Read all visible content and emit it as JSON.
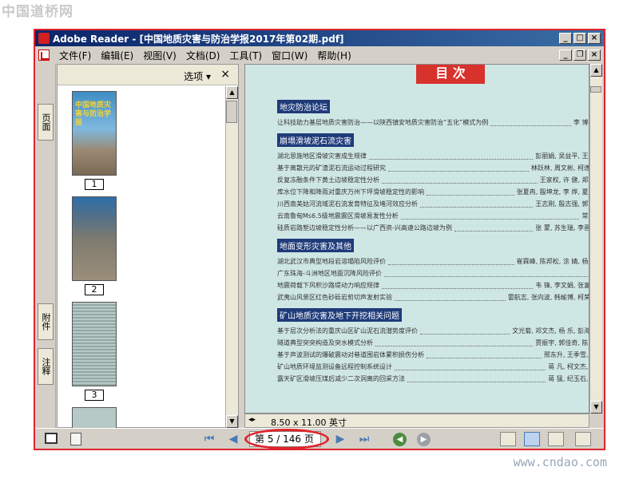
{
  "watermark_top": "中国道桥网",
  "watermark_bottom": "www.cndao.com",
  "window": {
    "title": "Adobe Reader - [中国地质灾害与防治学报2017年第02期.pdf]"
  },
  "menu": [
    "文件(F)",
    "编辑(E)",
    "视图(V)",
    "文档(D)",
    "工具(T)",
    "窗口(W)",
    "帮助(H)"
  ],
  "side_tabs": {
    "pages": "页面",
    "attachments": "附件",
    "comments": "注释"
  },
  "panel": {
    "options_label": "选项 ▾",
    "close": "×"
  },
  "thumbnails": [
    {
      "number": "1",
      "cover_text": "中国地质灾害与防治学报"
    },
    {
      "number": "2"
    },
    {
      "number": "3"
    }
  ],
  "document": {
    "toc_heading": "目 次",
    "sections": [
      {
        "title": "地灾防治论坛",
        "entries": [
          {
            "text": "让科技助力基层地质灾害防治——以陕西镇安地质灾害防治“五化”模式为例",
            "authors": "李 博  杨"
          }
        ]
      },
      {
        "title": "崩塌滑坡泥石流灾害",
        "entries": [
          {
            "text": "湖北恩施地区滑坡灾害成生规律",
            "authors": "彭丽娟, 吴益平, 王 飞"
          },
          {
            "text": "基于离散元的矿渣泥石流运动过程研究",
            "authors": "林跃林, 周文彬, 柯逸瑶"
          },
          {
            "text": "反复冻融条件下黄土边坡稳定性分析",
            "authors": "王家权, 许 健, 郑 刚"
          },
          {
            "text": "库水位下降和降雨对重庆万州下坪滑坡稳定性的影响",
            "authors": "张夏冉, 殷坤龙, 李 烨, 夏 辉"
          },
          {
            "text": "川西南美姑河流域泥石流发育特征及堵河效应分析",
            "authors": "王志刚, 殷志强, 郭 海"
          },
          {
            "text": "云南鲁甸Ms6.5级地震震区滑坡易发性分析",
            "authors": "常 昊"
          },
          {
            "text": "硅质岩路堑边坡稳定性分析——以广西资-兴高速公路边坡为例",
            "authors": "张 蒙, 苏生瑞, 李晋山"
          }
        ]
      },
      {
        "title": "地面变形灾害及其他",
        "entries": [
          {
            "text": "湖北武汉市典型地段岩溶塌陷风险评价",
            "authors": "崔霖峰, 陈邦松, 涂 婧, 杨 涛"
          },
          {
            "text": "广东珠海-斗洲地区地面沉降风险评价",
            "authors": ""
          },
          {
            "text": "地震荷载下风积沙路堤动力响应规律",
            "authors": "韦 锋, 李文娟, 张富贵"
          },
          {
            "text": "武夷山风景区红色砂砾岩剪切声发射实验",
            "authors": "雷航志, 张向波, 韩瑜博, 柯荣利"
          }
        ]
      },
      {
        "title": "矿山地质灾害及地下开挖相关问题",
        "entries": [
          {
            "text": "基于层次分析法的重庆山区矿山泥石流潜势度评价",
            "authors": "文光菊, 邓文杰, 杨 乐, 彭海游"
          },
          {
            "text": "隧道典型突突构造及突水模式分析",
            "authors": "贾振宇, 郭佳奇, 陈 帆"
          },
          {
            "text": "基于声波测试的爆破震动对巷道围岩体累积损伤分析",
            "authors": "邢东升, 王季雪, 刘"
          },
          {
            "text": "矿山地质环境监测设备远程控制系统设计",
            "authors": "蒋 凡, 柯文杰, 张"
          },
          {
            "text": "露天矿区滑坡压煤后减少二次洞离的回采方法",
            "authors": "蒋 猛, 纪玉石, 王"
          }
        ]
      }
    ]
  },
  "statusbar": {
    "page_size": "8.50 x 11.00 英寸"
  },
  "navigation": {
    "page_display": "第 5 / 146 页",
    "current_page": 5,
    "total_pages": 146
  }
}
